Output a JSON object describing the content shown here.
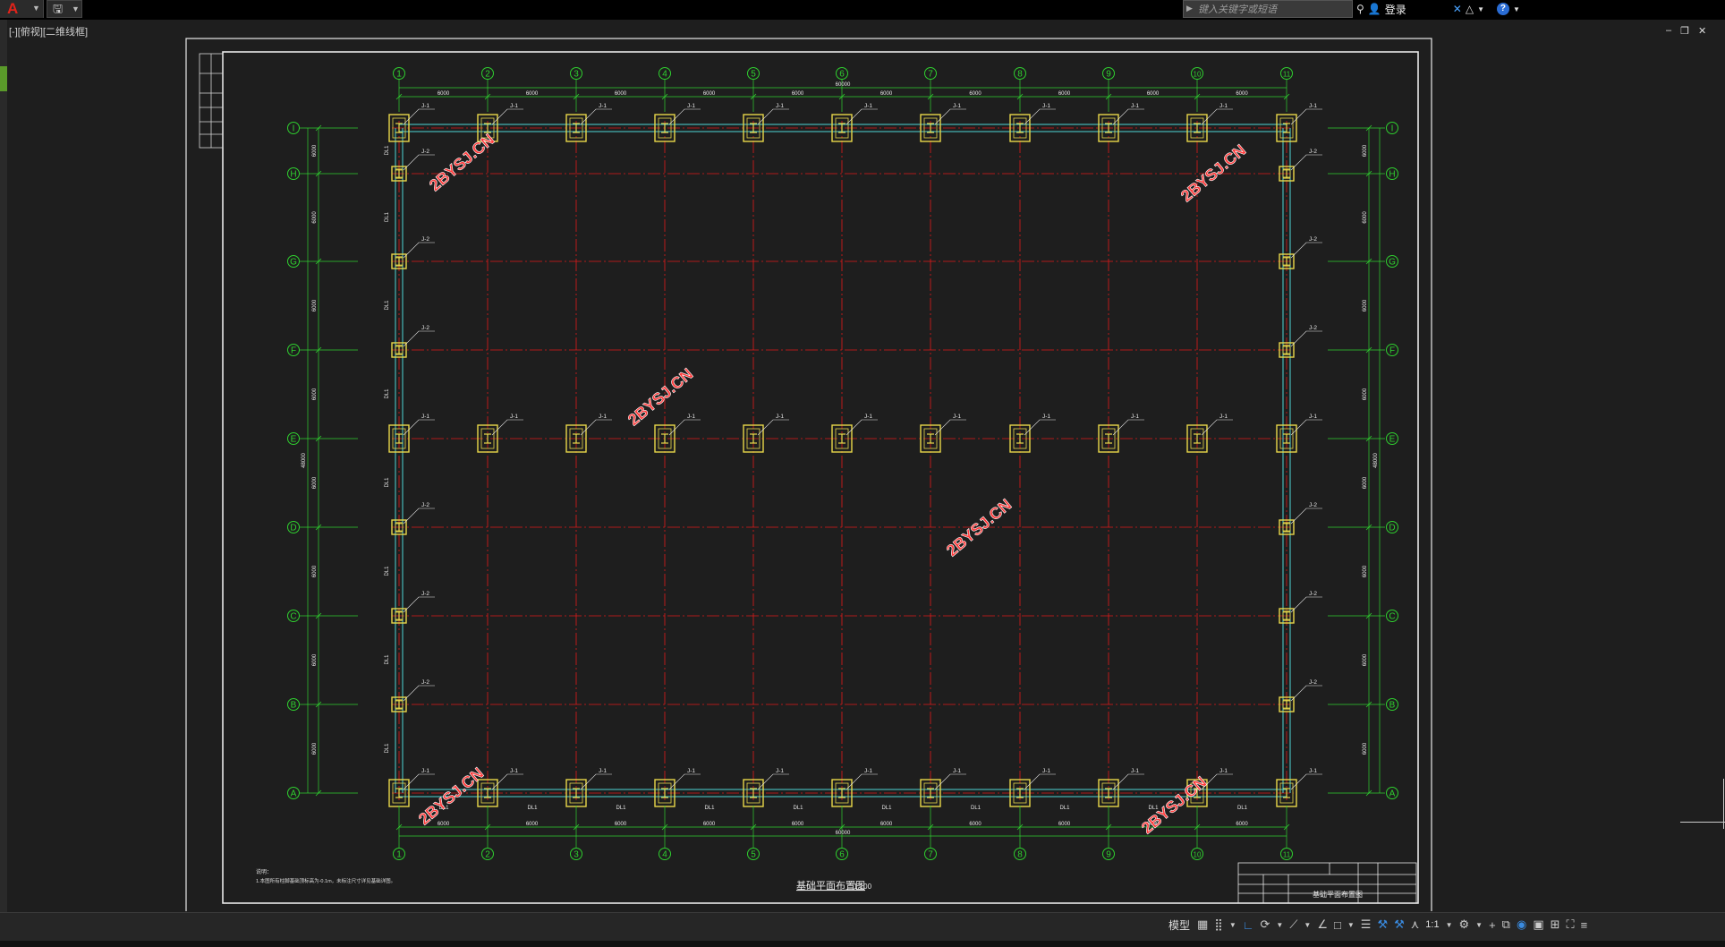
{
  "app": {
    "search_placeholder": "键入关键字或短语",
    "login_label": "登录",
    "viewport_label": "[-][俯视][二维线框]"
  },
  "window_controls": [
    "–",
    "❐",
    "✕"
  ],
  "drawing": {
    "column_axes": [
      "1",
      "2",
      "3",
      "4",
      "5",
      "6",
      "7",
      "8",
      "9",
      "10",
      "11"
    ],
    "row_axes": [
      "A",
      "B",
      "C",
      "D",
      "E",
      "F",
      "G",
      "H",
      "I"
    ],
    "top_spacing_labels": [
      "6000",
      "6000",
      "6000",
      "6000",
      "6000",
      "6000",
      "6000",
      "6000",
      "6000",
      "6000"
    ],
    "top_total_label": "60000",
    "bottom_spacing_labels": [
      "6000",
      "6000",
      "6000",
      "6000",
      "6000",
      "6000",
      "6000",
      "6000",
      "6000",
      "6000"
    ],
    "bottom_total_label": "60000",
    "left_spacing_labels": [
      "6000",
      "6000",
      "6000",
      "6000",
      "6000",
      "6000",
      "6000",
      "6000"
    ],
    "left_total_label": "48000",
    "right_spacing_labels": [
      "6000",
      "6000",
      "6000",
      "6000",
      "6000",
      "6000",
      "6000",
      "6000"
    ],
    "right_total_label": "48000",
    "footing_labels": {
      "type1": "J-1",
      "type2": "J-2"
    },
    "beam_label": "DL1",
    "plan_title": "基础平面布置图",
    "plan_scale": "1:100",
    "notes_heading": "说明：",
    "notes_text": "1.本图所有柱脚基础顶标高为-0.1m，未标注尺寸详见基础详图。",
    "title_block_drawing_name": "基础平面布置图",
    "watermark": "2BYSJ.CN"
  },
  "statusbar": {
    "model_label": "模型",
    "scale_label": "1:1"
  },
  "colors": {
    "grid_red": "#e01a1a",
    "axis_green": "#2fd02f",
    "footing_yellow": "#e8d84a",
    "beam_cyan": "#4fd6d6",
    "watermark_red": "#ff3b3b",
    "frame_white": "#e8e8e8"
  }
}
